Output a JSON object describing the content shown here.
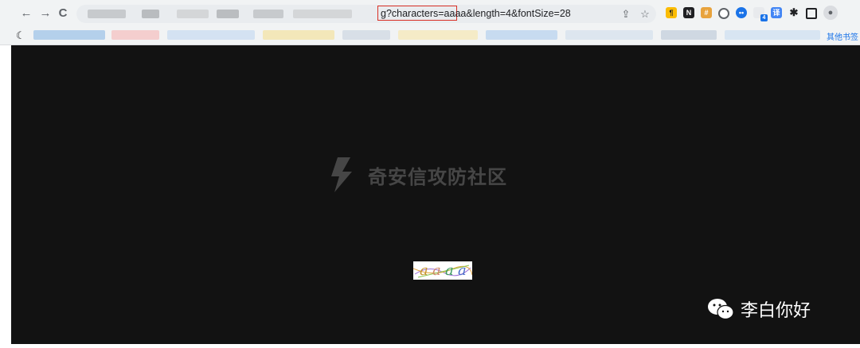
{
  "browser": {
    "nav": {
      "back": "←",
      "forward": "→",
      "reload": "C"
    },
    "url_visible": "g?characters=aaaa&length=4&fontSize=28",
    "extensions": [
      "paragraph-icon",
      "n-extension-icon",
      "slack-like-icon",
      "circle-icon",
      "eyes-icon",
      "puzzle-badge-icon",
      "translate-icon",
      "extensions-puzzle-icon",
      "window-icon",
      "profile-icon"
    ],
    "ext_badge_1": "4",
    "bookmarks_other": "其他书签"
  },
  "page": {
    "watermark_text": "奇安信攻防社区",
    "captcha_chars": [
      "a",
      "a",
      "a",
      "a"
    ],
    "wechat_label": "李白你好"
  },
  "colors": {
    "page_bg": "#121212",
    "highlight": "#d93025",
    "toolbar": "#f1f3f4"
  }
}
